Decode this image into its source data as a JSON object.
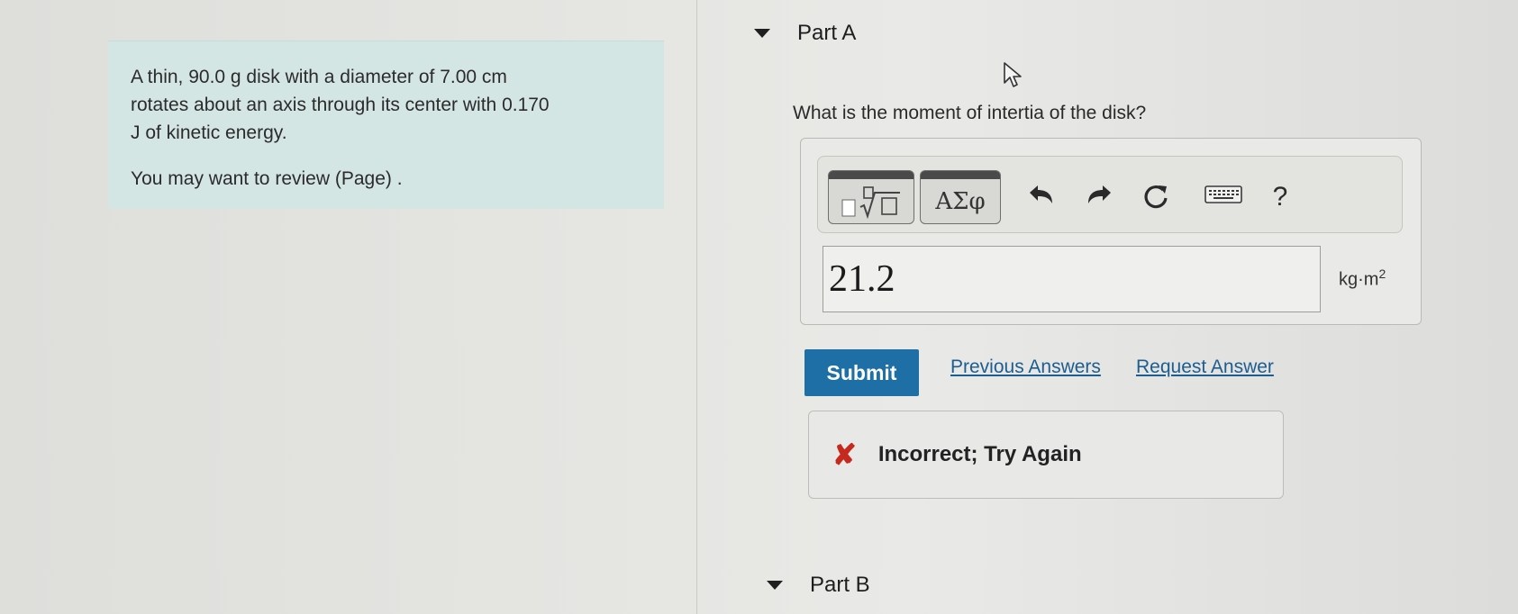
{
  "problem": {
    "text_line1": "A thin, 90.0 g disk with a diameter of 7.00 cm",
    "text_line2": "rotates about an axis through its center with 0.170",
    "text_line3": "J of kinetic energy.",
    "review": "You may want to review (Page) ."
  },
  "part_a": {
    "title": "Part A",
    "question": "What is the moment of intertia of the disk?",
    "toolbar": {
      "templates_icon": "templates-icon",
      "greek_label": "ΑΣφ",
      "undo_icon": "undo-icon",
      "redo_icon": "redo-icon",
      "reset_icon": "reset-icon",
      "keyboard_icon": "keyboard-icon",
      "help_label": "?"
    },
    "answer_value": "21.2",
    "unit_base": "kg·m",
    "unit_exp": "2",
    "submit_label": "Submit",
    "previous_answers_label": "Previous Answers",
    "request_answer_label": "Request Answer",
    "feedback_icon": "incorrect-x-icon",
    "feedback_text": "Incorrect; Try Again"
  },
  "part_b": {
    "title": "Part B"
  },
  "colors": {
    "problem_bg": "#d4e6e4",
    "submit_bg": "#1d6fa5",
    "link": "#1d5d8f",
    "incorrect": "#c62a1e"
  }
}
